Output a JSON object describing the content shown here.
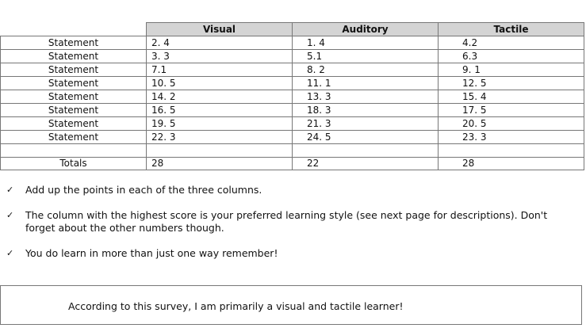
{
  "table": {
    "headers": [
      "",
      "Visual",
      "Auditory",
      "Tactile"
    ],
    "rows": [
      [
        "Statement",
        "2. 4",
        "1. 4",
        "4.2"
      ],
      [
        "Statement",
        "3. 3",
        "5.1",
        "6.3"
      ],
      [
        "Statement",
        "7.1",
        "8. 2",
        "9. 1"
      ],
      [
        "Statement",
        "10. 5",
        "11. 1",
        "12. 5"
      ],
      [
        "Statement",
        "14. 2",
        "13. 3",
        "15. 4"
      ],
      [
        "Statement",
        "16. 5",
        "18. 3",
        "17. 5"
      ],
      [
        "Statement",
        "19. 5",
        "21. 3",
        "20. 5"
      ],
      [
        "Statement",
        "22. 3",
        "24. 5",
        "23. 3"
      ]
    ],
    "totals": [
      "Totals",
      "28",
      "22",
      "28"
    ]
  },
  "notes": [
    "Add up the points in each of the three columns.",
    "The column with the highest score is your preferred learning style (see next page for descriptions). Don't forget about the other numbers though.",
    "You do learn in more than just one way remember!"
  ],
  "check_icon": "✓",
  "summary": "According to this survey, I am primarily a visual and tactile learner!"
}
